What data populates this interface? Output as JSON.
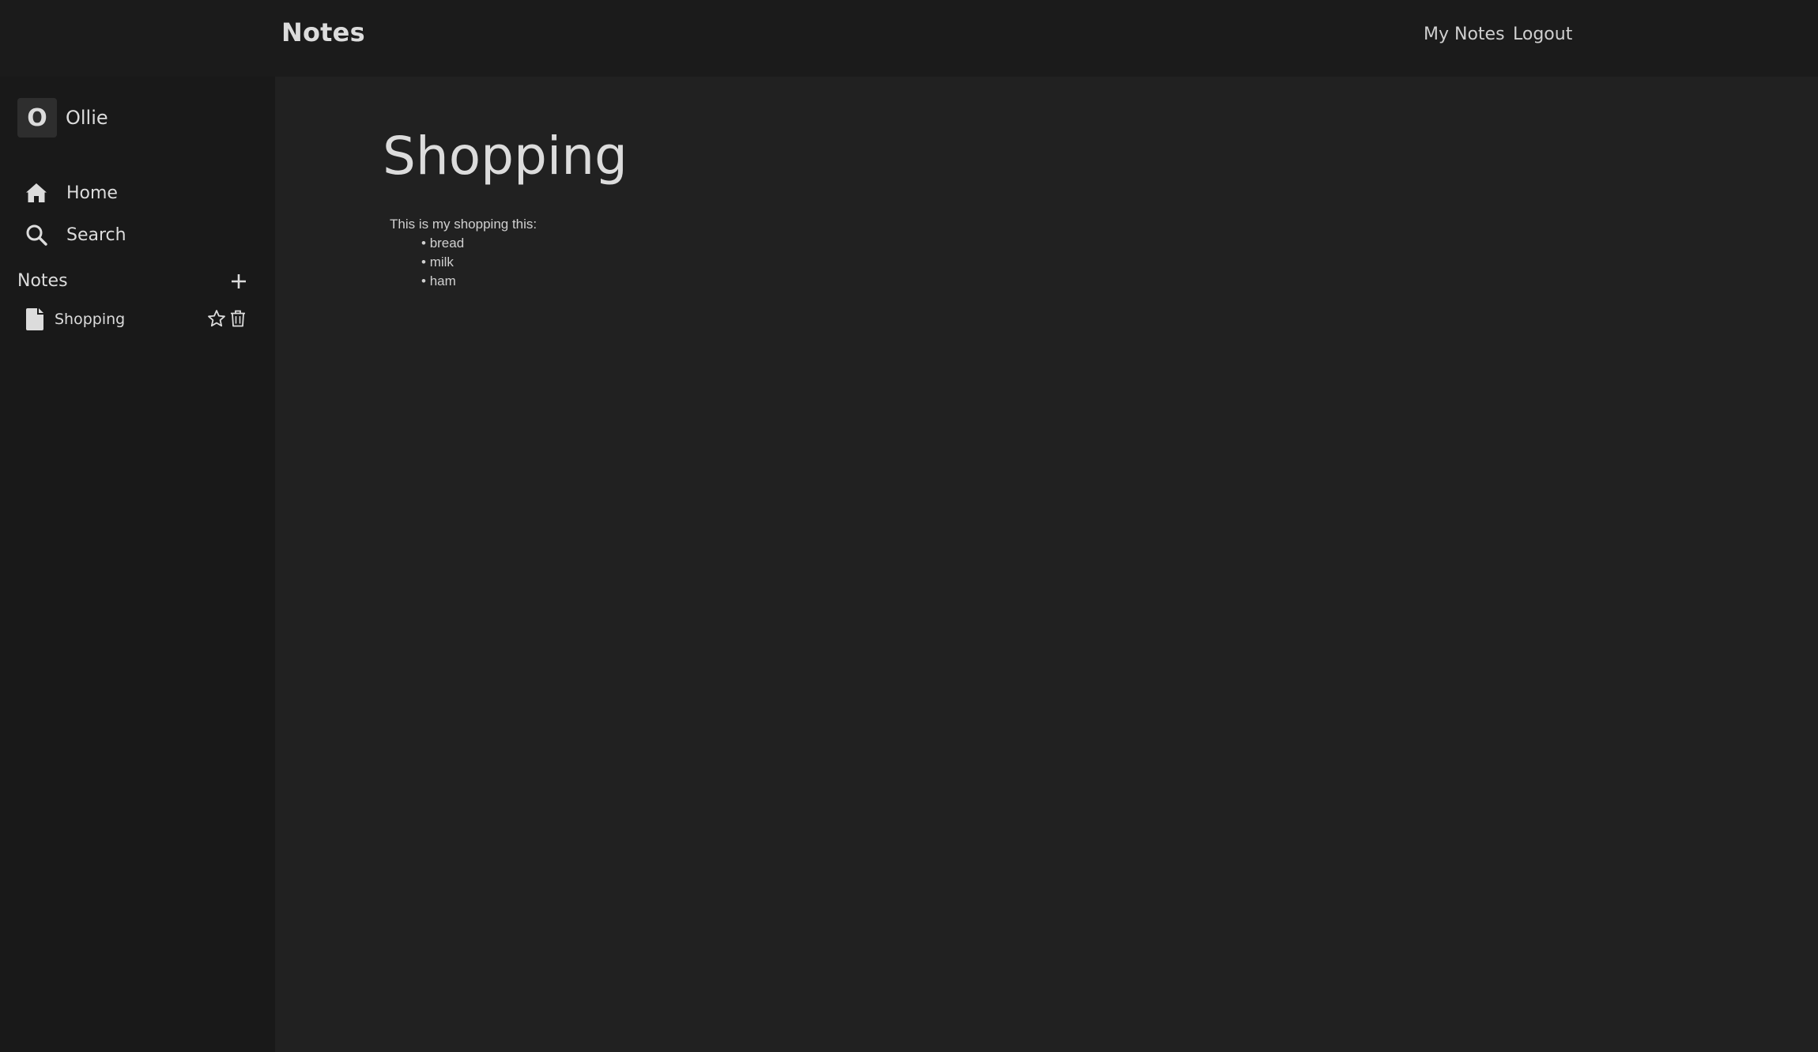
{
  "navbar": {
    "brand": "Notes",
    "links": [
      {
        "label": "My Notes"
      },
      {
        "label": "Logout"
      }
    ]
  },
  "sidebar": {
    "user": {
      "initial": "O",
      "name": "Ollie"
    },
    "nav": [
      {
        "label": "Home",
        "icon": "home-icon"
      },
      {
        "label": "Search",
        "icon": "search-icon"
      }
    ],
    "notes_section": {
      "title": "Notes",
      "add_icon": "plus-icon",
      "items": [
        {
          "label": "Shopping",
          "icon": "document-icon",
          "actions": [
            "star-icon",
            "trash-icon"
          ]
        }
      ]
    }
  },
  "main": {
    "title": "Shopping",
    "intro": "This is my shopping this:",
    "items": [
      "bread",
      "milk",
      "ham"
    ]
  },
  "colors": {
    "background": "#191919",
    "content_background": "#212121",
    "text": "#dcdcdc",
    "avatar_background": "#2e2e2e"
  }
}
